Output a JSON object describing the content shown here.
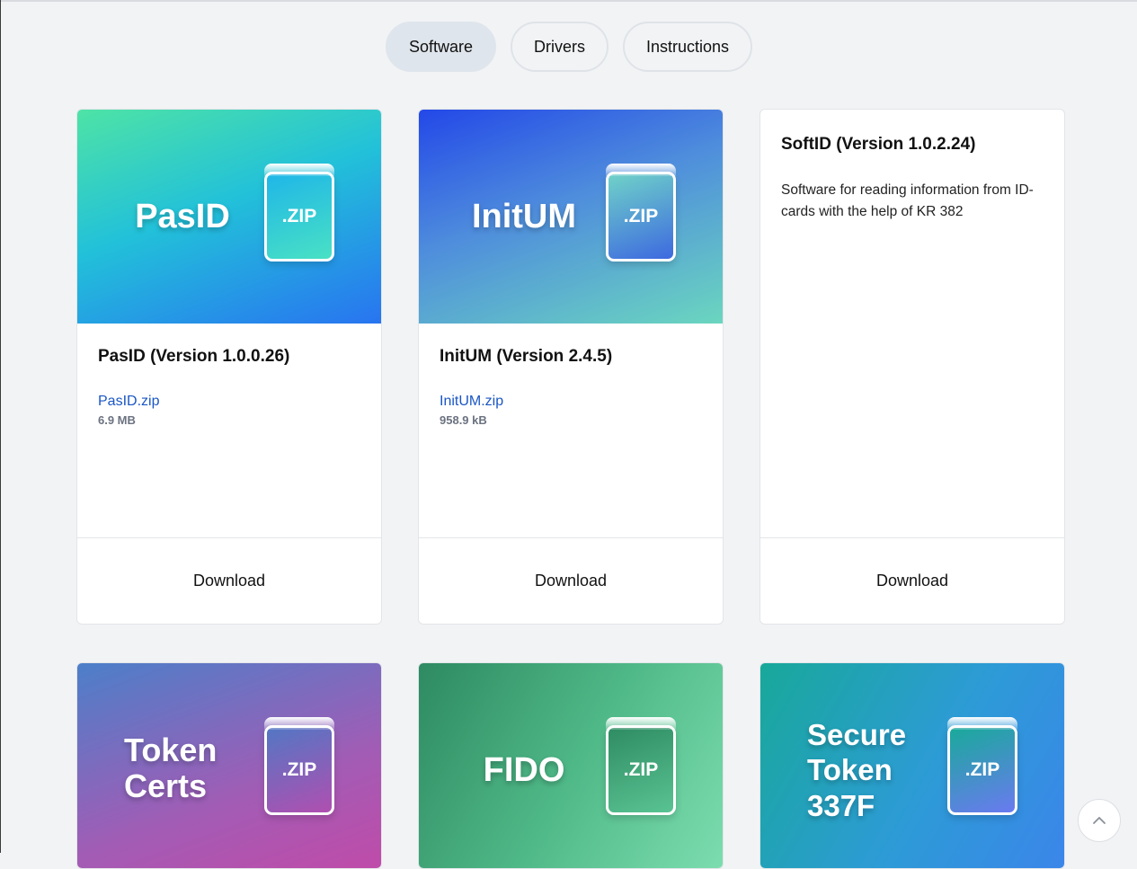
{
  "tabs": [
    {
      "label": "Software",
      "active": true
    },
    {
      "label": "Drivers",
      "active": false
    },
    {
      "label": "Instructions",
      "active": false
    }
  ],
  "cards": [
    {
      "banner": "PasID",
      "zip_label": ".ZIP",
      "title": "PasID (Version 1.0.0.26)",
      "file": "PasID.zip",
      "size": "6.9 MB",
      "action": "Download"
    },
    {
      "banner": "InitUM",
      "zip_label": ".ZIP",
      "title": "InitUM (Version 2.4.5)",
      "file": "InitUM.zip",
      "size": "958.9 kB",
      "action": "Download"
    },
    {
      "title": "SoftID (Version 1.0.2.24)",
      "description": "Software for reading information from ID-cards with the help of KR 382",
      "action": "Download"
    },
    {
      "banner_lines": [
        "Token",
        "Certs"
      ],
      "zip_label": ".ZIP"
    },
    {
      "banner": "FIDO",
      "zip_label": ".ZIP"
    },
    {
      "banner_lines": [
        "Secure",
        "Token",
        "337F"
      ],
      "zip_label": ".ZIP"
    }
  ],
  "icons": {
    "scroll_top": "chevron-up-icon",
    "file": "zip-file-icon"
  }
}
